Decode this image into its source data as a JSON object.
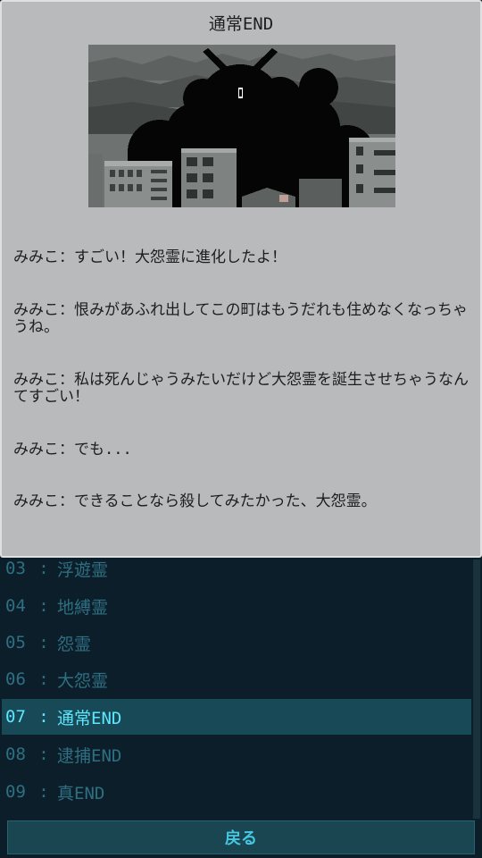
{
  "dialog": {
    "title": "通常END",
    "lines": [
      "みみこ：すごい！大怨霊に進化したよ！",
      "みみこ：恨みがあふれ出してこの町はもうだれも住めなくなっちゃうね。",
      "みみこ：私は死んじゃうみたいだけど大怨霊を誕生させちゃうなんてすごい！",
      "みみこ：でも...",
      "みみこ：できることなら殺してみたかった、大怨霊。"
    ],
    "illustration": "silhouette-monster-over-city"
  },
  "endings": [
    {
      "num": "03",
      "sep": ":",
      "title": "浮遊霊",
      "selected": false
    },
    {
      "num": "04",
      "sep": ":",
      "title": "地縛霊",
      "selected": false
    },
    {
      "num": "05",
      "sep": ":",
      "title": "怨霊",
      "selected": false
    },
    {
      "num": "06",
      "sep": ":",
      "title": "大怨霊",
      "selected": false
    },
    {
      "num": "07",
      "sep": ":",
      "title": "通常END",
      "selected": true
    },
    {
      "num": "08",
      "sep": ":",
      "title": "逮捕END",
      "selected": false
    },
    {
      "num": "09",
      "sep": ":",
      "title": "真END",
      "selected": false
    }
  ],
  "back_label": "戻る",
  "colors": {
    "dialog_bg": "#b9babc",
    "list_bg": "#0b1e29",
    "row_text": "#2f6f82",
    "selected_bg": "#174a56",
    "selected_text": "#5fe6ff",
    "button_text": "#47c6e0"
  }
}
